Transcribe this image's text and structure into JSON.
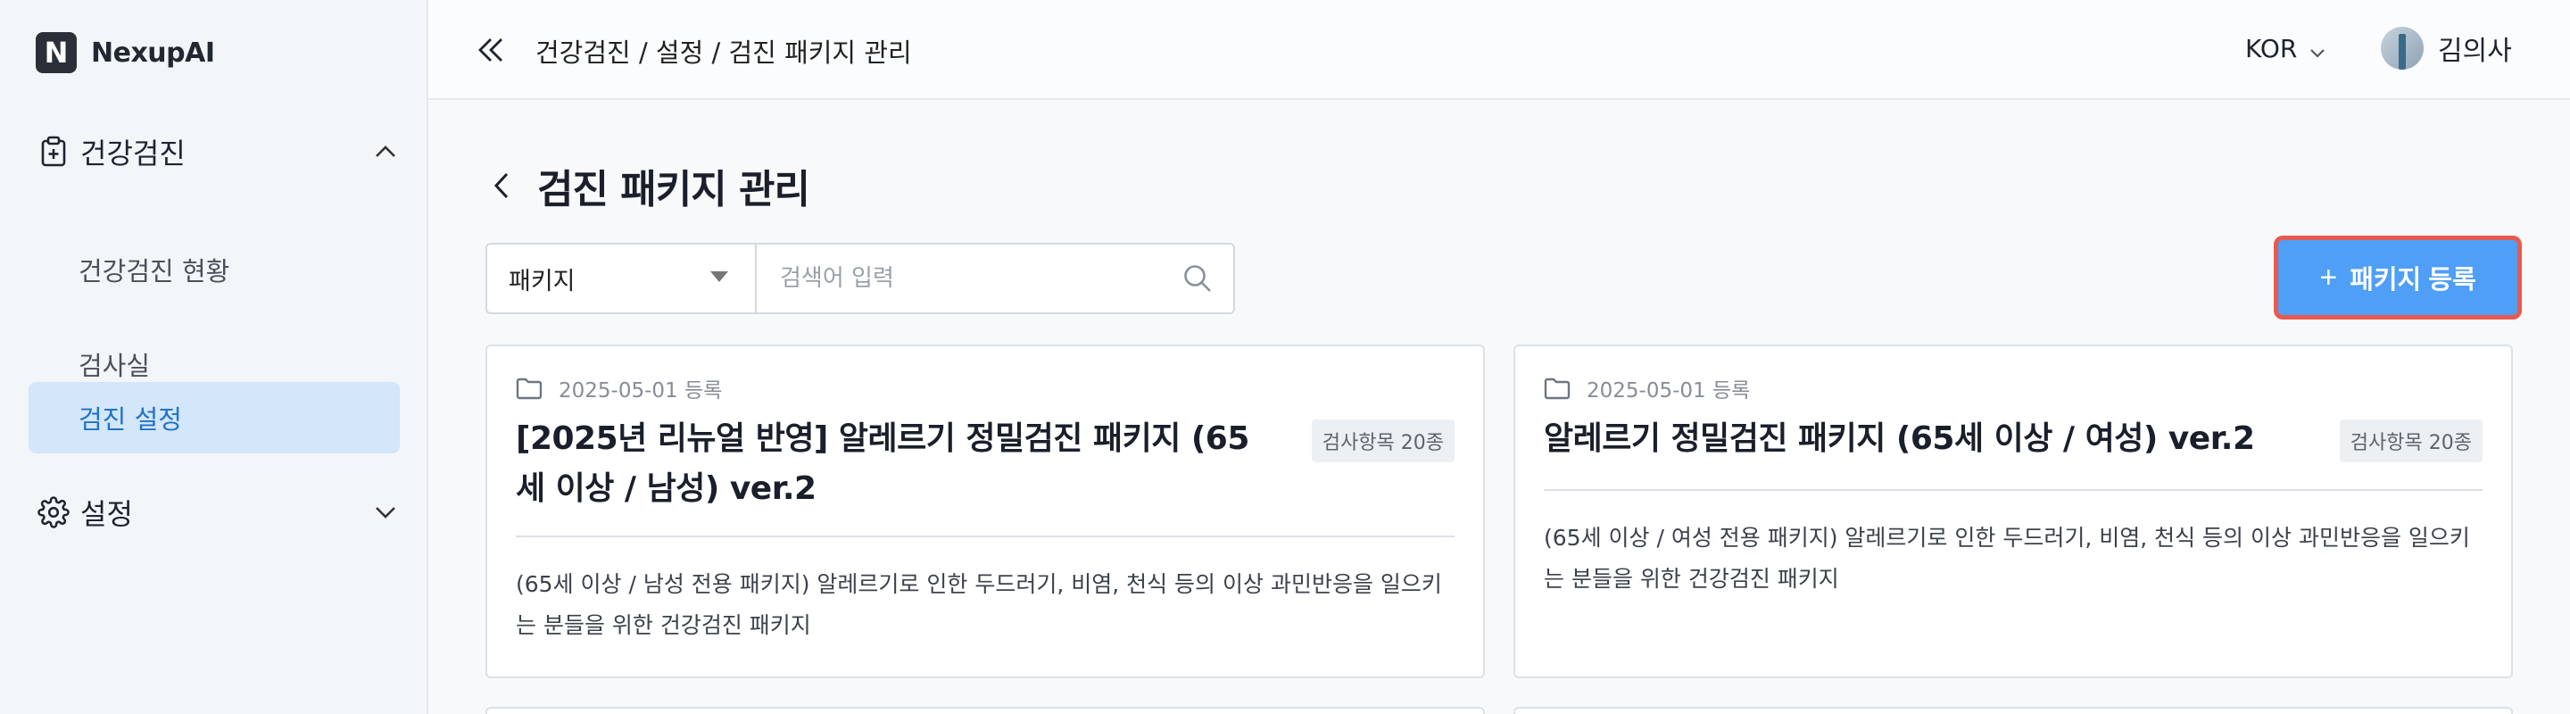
{
  "brand": {
    "name": "NexupAI",
    "logo_letter": "N"
  },
  "sidebar": {
    "groups": [
      {
        "label": "건강검진",
        "icon": "clipboard-plus-icon",
        "expanded": true
      },
      {
        "label": "설정",
        "icon": "gear-icon",
        "expanded": false
      }
    ],
    "items": [
      {
        "label": "건강검진 현황"
      },
      {
        "label": "검사실"
      },
      {
        "label": "검진 설정",
        "active": true
      }
    ]
  },
  "topbar": {
    "breadcrumb": "건강검진 / 설정 / 검진 패키지 관리",
    "language": "KOR",
    "user_name": "김의사"
  },
  "page": {
    "title": "검진 패키지 관리",
    "filter": {
      "selected": "패키지",
      "search_placeholder": "검색어 입력"
    },
    "add_button": {
      "plus": "+",
      "label": "패키지 등록"
    }
  },
  "cards": [
    {
      "date": "2025-05-01 등록",
      "title": "[2025년 리뉴얼 반영] 알레르기 정밀검진 패키지 (65세 이상 / 남성) ver.2",
      "badge": "검사항목 20종",
      "description": "(65세 이상 / 남성 전용 패키지) 알레르기로 인한 두드러기, 비염, 천식 등의 이상 과민반응을 일으키는 분들을 위한 건강검진 패키지"
    },
    {
      "date": "2025-05-01 등록",
      "title": "알레르기 정밀검진 패키지 (65세 이상 / 여성) ver.2",
      "badge": "검사항목 20종",
      "description": "(65세 이상 / 여성 전용 패키지) 알레르기로 인한 두드러기, 비염, 천식 등의 이상 과민반응을 일으키는 분들을 위한 건강검진 패키지"
    }
  ],
  "colors": {
    "accent": "#4f9ff6",
    "highlight_border": "#e85a4f",
    "active_item_bg": "#d3e6fa",
    "active_item_text": "#2173c6"
  }
}
